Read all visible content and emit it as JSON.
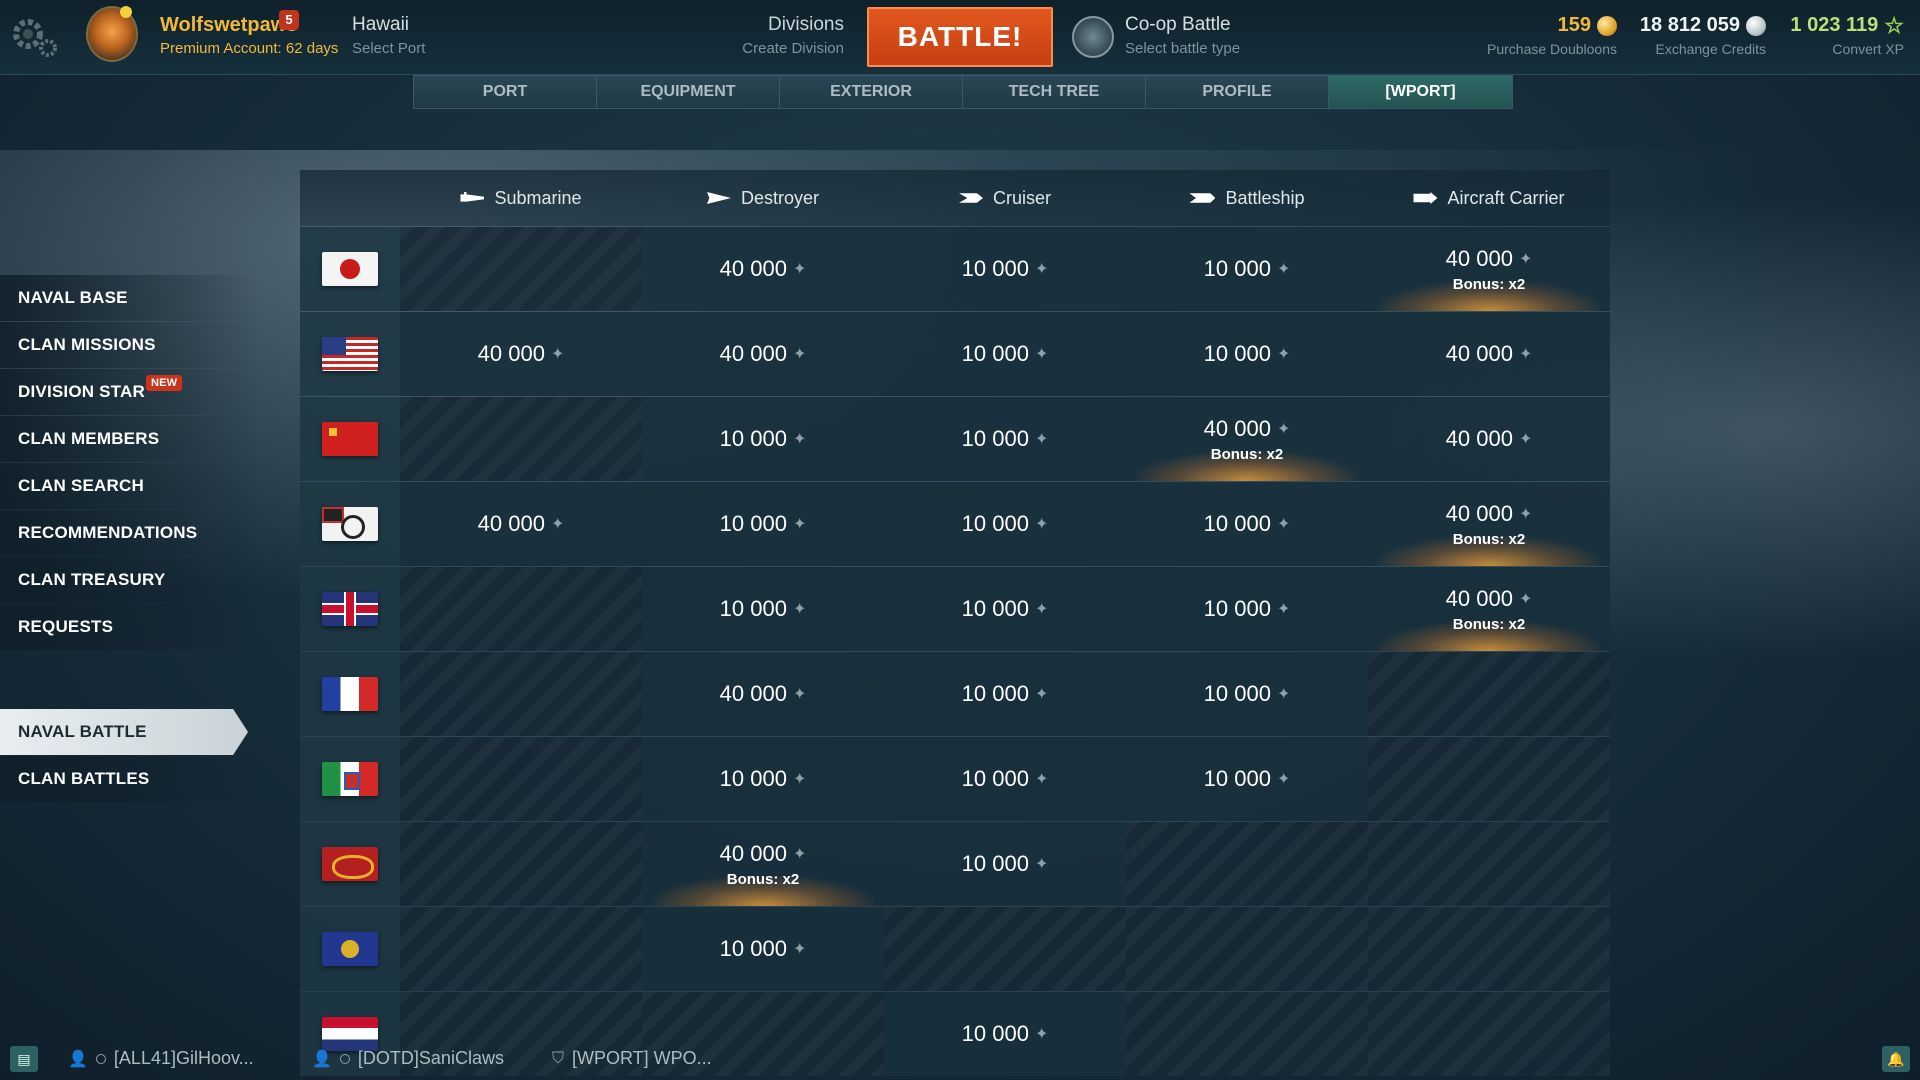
{
  "topbar": {
    "username": "Wolfswetpaws",
    "username_badge": "5",
    "premium": "Premium Account: 62 days",
    "port": {
      "title": "Hawaii",
      "subtitle": "Select Port"
    },
    "division": {
      "title": "Divisions",
      "subtitle": "Create Division"
    },
    "battle_label": "BATTLE!",
    "battle_type": {
      "title": "Co-op Battle",
      "subtitle": "Select battle type"
    },
    "resources": [
      {
        "value": "159",
        "label": "Purchase Doubloons",
        "icon": "doubloon-icon"
      },
      {
        "value": "18 812 059",
        "label": "Exchange Credits",
        "icon": "credits-icon"
      },
      {
        "value": "1 023 119",
        "label": "Convert XP",
        "icon": "free-xp-star-icon"
      }
    ]
  },
  "tabs": [
    {
      "label": "PORT",
      "active": false
    },
    {
      "label": "EQUIPMENT",
      "active": false
    },
    {
      "label": "EXTERIOR",
      "active": false
    },
    {
      "label": "TECH TREE",
      "active": false
    },
    {
      "label": "PROFILE",
      "active": false
    },
    {
      "label": "[WPORT]",
      "active": true
    }
  ],
  "sidebar": {
    "items": [
      {
        "label": "NAVAL BASE"
      },
      {
        "label": "CLAN MISSIONS"
      },
      {
        "label": "DIVISION STAR",
        "badge": "NEW"
      },
      {
        "label": "CLAN MEMBERS"
      },
      {
        "label": "CLAN SEARCH"
      },
      {
        "label": "RECOMMENDATIONS"
      },
      {
        "label": "CLAN TREASURY"
      },
      {
        "label": "REQUESTS"
      }
    ],
    "battle_items": [
      {
        "label": "NAVAL BATTLE",
        "active": true
      },
      {
        "label": "CLAN BATTLES",
        "active": false
      }
    ]
  },
  "table": {
    "columns": [
      {
        "label": "Submarine",
        "icon": "submarine-icon"
      },
      {
        "label": "Destroyer",
        "icon": "destroyer-icon"
      },
      {
        "label": "Cruiser",
        "icon": "cruiser-icon"
      },
      {
        "label": "Battleship",
        "icon": "battleship-icon"
      },
      {
        "label": "Aircraft Carrier",
        "icon": "aircraft-carrier-icon"
      }
    ],
    "bonus_label": "Bonus: x2",
    "rows": [
      {
        "nation": "japan",
        "cells": [
          null,
          {
            "v": "40 000"
          },
          {
            "v": "10 000"
          },
          {
            "v": "10 000"
          },
          {
            "v": "40 000",
            "bonus": true
          }
        ]
      },
      {
        "nation": "usa",
        "cells": [
          {
            "v": "40 000"
          },
          {
            "v": "40 000"
          },
          {
            "v": "10 000"
          },
          {
            "v": "10 000"
          },
          {
            "v": "40 000"
          }
        ]
      },
      {
        "nation": "ussr",
        "cells": [
          null,
          {
            "v": "10 000"
          },
          {
            "v": "10 000"
          },
          {
            "v": "40 000",
            "bonus": true
          },
          {
            "v": "40 000"
          }
        ]
      },
      {
        "nation": "germany",
        "cells": [
          {
            "v": "40 000"
          },
          {
            "v": "10 000"
          },
          {
            "v": "10 000"
          },
          {
            "v": "10 000"
          },
          {
            "v": "40 000",
            "bonus": true
          }
        ]
      },
      {
        "nation": "uk",
        "cells": [
          null,
          {
            "v": "10 000"
          },
          {
            "v": "10 000"
          },
          {
            "v": "10 000"
          },
          {
            "v": "40 000",
            "bonus": true
          }
        ]
      },
      {
        "nation": "france",
        "cells": [
          null,
          {
            "v": "40 000"
          },
          {
            "v": "10 000"
          },
          {
            "v": "10 000"
          },
          null
        ]
      },
      {
        "nation": "italy",
        "cells": [
          null,
          {
            "v": "10 000"
          },
          {
            "v": "10 000"
          },
          {
            "v": "10 000"
          },
          null
        ]
      },
      {
        "nation": "panasia",
        "cells": [
          null,
          {
            "v": "40 000",
            "bonus": true
          },
          {
            "v": "10 000"
          },
          null,
          null
        ]
      },
      {
        "nation": "europe",
        "cells": [
          null,
          {
            "v": "10 000"
          },
          null,
          null,
          null
        ]
      },
      {
        "nation": "netherlands",
        "cells": [
          null,
          null,
          {
            "v": "10 000"
          },
          null,
          null
        ]
      }
    ]
  },
  "chat": {
    "contacts": [
      {
        "label": "[ALL41]GilHoov..."
      },
      {
        "label": "[DOTD]SaniClaws"
      },
      {
        "label": "[WPORT] WPO..."
      }
    ]
  }
}
